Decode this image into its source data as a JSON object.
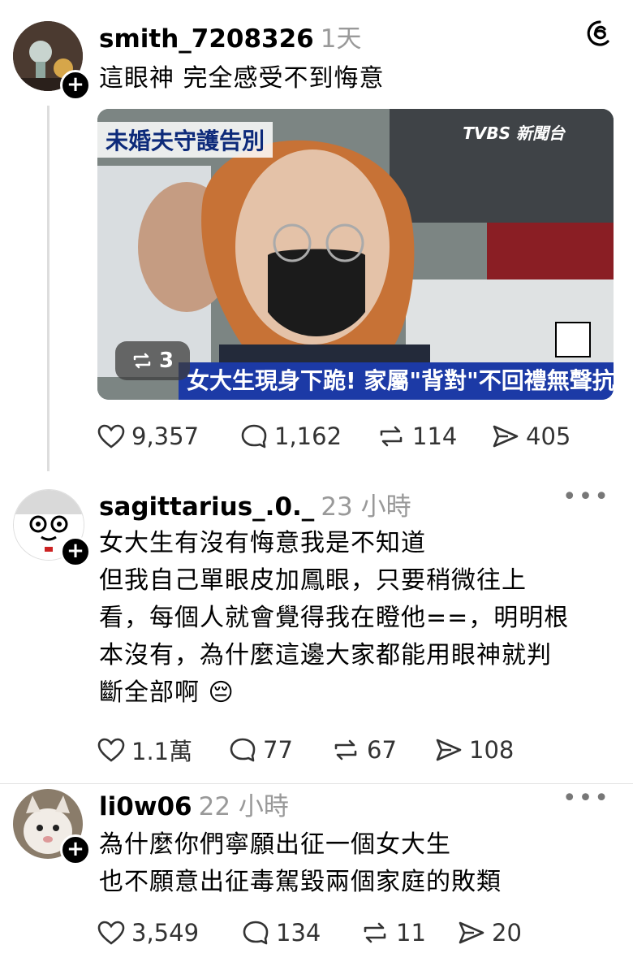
{
  "header_icon": "threads-icon",
  "posts": [
    {
      "username": "smith_7208326",
      "time": "1天",
      "text": "這眼神 完全感受不到悔意",
      "image": {
        "top_caption": "未婚夫守護告別",
        "channel": "TVBS 新聞台",
        "bottom_caption": "女大生現身下跪! 家屬\"背對\"不回禮無聲抗議",
        "repost_badge": "3"
      },
      "likes": "9,357",
      "comments": "1,162",
      "reposts": "114",
      "shares": "405"
    },
    {
      "username": "sagittarius_.0._",
      "time": "23 小時",
      "text": "女大生有沒有悔意我是不知道\n但我自己單眼皮加鳳眼，只要稍微往上\n看，每個人就會覺得我在瞪他==，明明根\n本沒有，為什麼這邊大家都能用眼神就判\n斷全部啊 😔",
      "likes": "1.1萬",
      "comments": "77",
      "reposts": "67",
      "shares": "108"
    },
    {
      "username": "li0w06",
      "time": "22 小時",
      "text": "為什麼你們寧願出征一個女大生\n也不願意出征毒駕毀兩個家庭的敗類",
      "likes": "3,549",
      "comments": "134",
      "reposts": "11",
      "shares": "20"
    }
  ]
}
